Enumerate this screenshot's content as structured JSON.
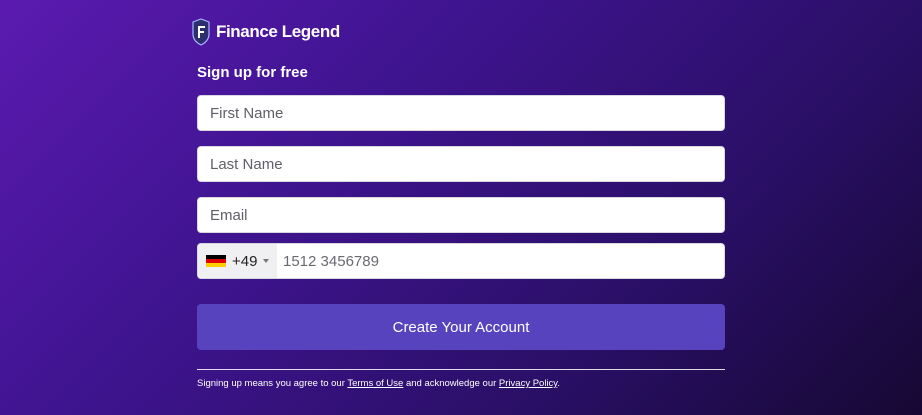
{
  "brand": {
    "name": "Finance Legend",
    "logo_icon": "shield-logo-icon"
  },
  "form": {
    "title": "Sign up for free",
    "first_name_placeholder": "First Name",
    "last_name_placeholder": "Last Name",
    "email_placeholder": "Email",
    "phone": {
      "country_flag": "germany-flag-icon",
      "dial_code": "+49",
      "placeholder": "1512 3456789"
    },
    "submit_label": "Create Your Account"
  },
  "legal": {
    "prefix": "Signing up means you agree to our ",
    "terms_label": "Terms of Use",
    "middle": " and acknowledge our ",
    "privacy_label": "Privacy Policy",
    "suffix": "."
  },
  "colors": {
    "button": "#5843bf",
    "background_start": "#5b1ab0",
    "background_end": "#160833"
  }
}
